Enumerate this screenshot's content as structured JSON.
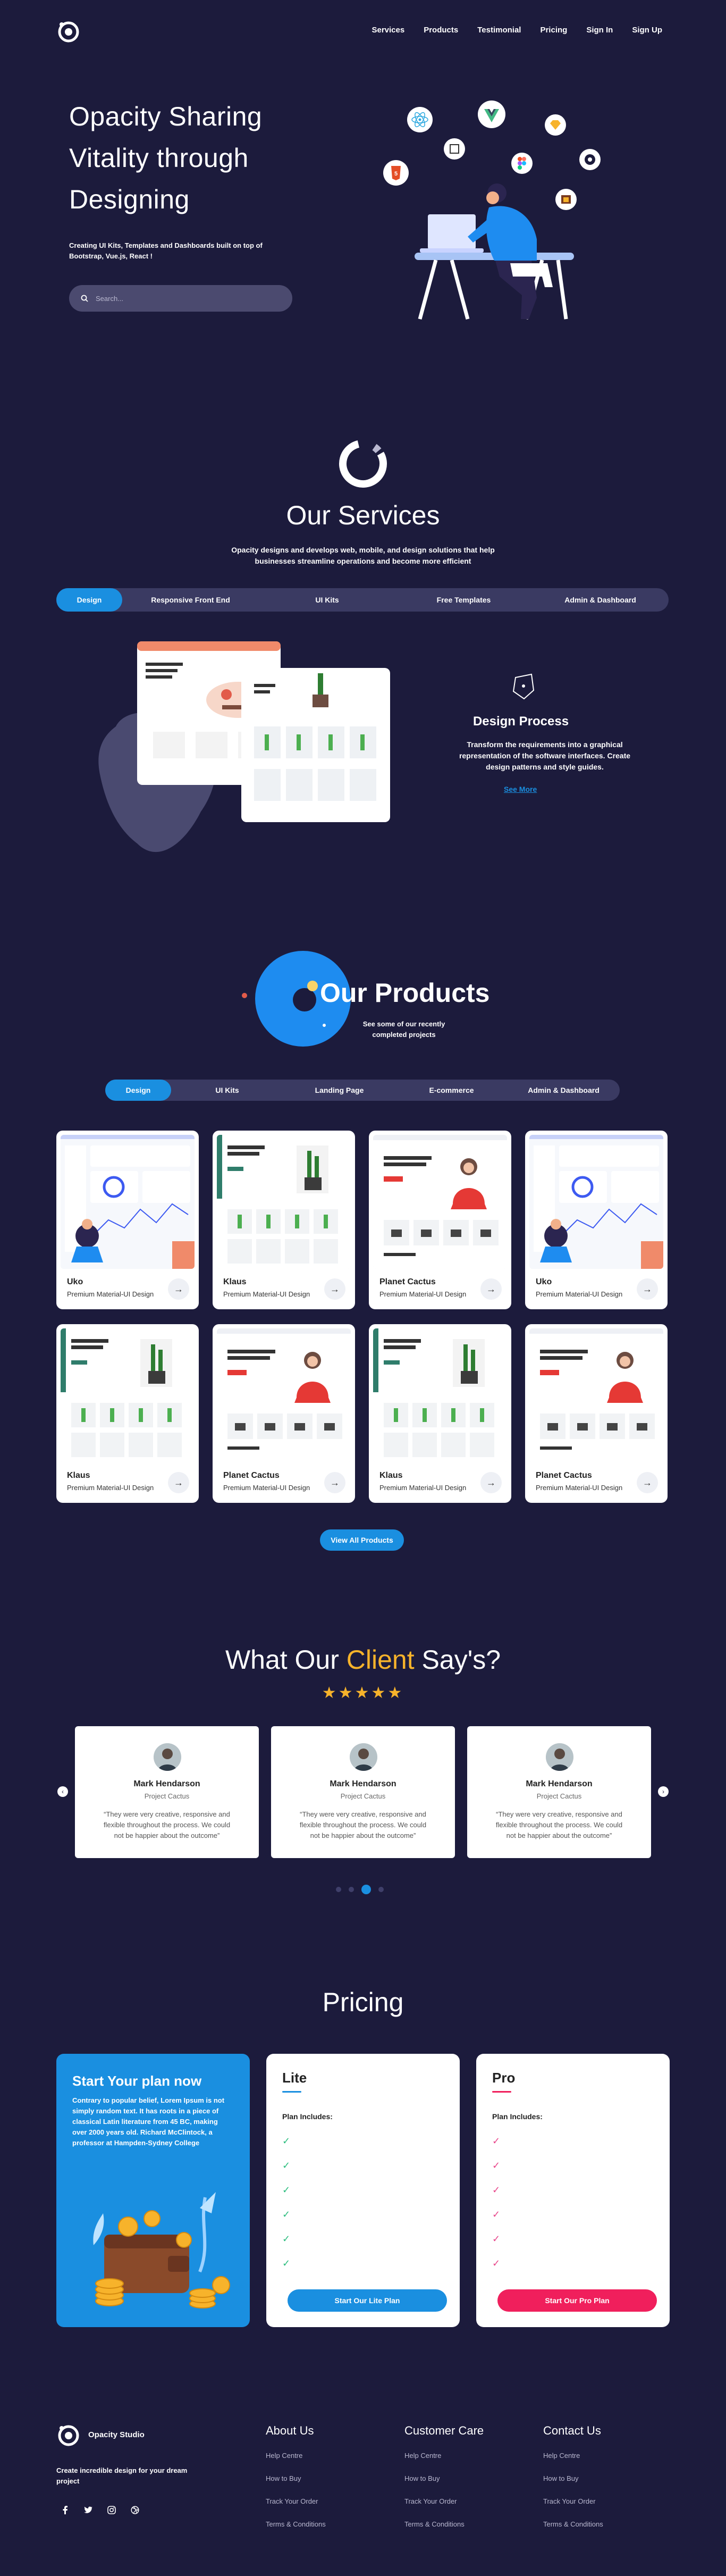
{
  "nav": {
    "links": [
      "Services",
      "Products",
      "Testimonial",
      "Pricing",
      "Sign In",
      "Sign Up"
    ]
  },
  "hero": {
    "title": "Opacity Sharing Vitality through Designing",
    "subtitle": "Creating UI Kits, Templates and Dashboards built on top of Bootstrap, Vue.js, React !",
    "search_placeholder": "Search...",
    "tech_icons": [
      "react-icon",
      "vue-icon",
      "sketch-icon",
      "html5-icon",
      "figma-icon",
      "sass-icon",
      "js-icon",
      "folder-icon"
    ]
  },
  "services": {
    "title": "Our Services",
    "description": "Opacity designs and develops web, mobile, and design solutions that help businesses streamline operations and become more efficient",
    "tabs": [
      "Design",
      "Responsive Front End",
      "UI Kits",
      "Free Templates",
      "Admin & Dashboard"
    ],
    "active_tab": "Design",
    "feature_title": "Design Process",
    "feature_desc": "Transform the requirements into a graphical representation of the software interfaces. Create design patterns and style guides.",
    "see_more": "See More"
  },
  "products": {
    "title": "Our Products",
    "subtitle": "See some of our recently completed projects",
    "tabs": [
      "Design",
      "UI Kits",
      "Landing Page",
      "E-commerce",
      "Admin & Dashboard"
    ],
    "active_tab": "Design",
    "items": [
      {
        "name": "Uko",
        "sub": "Premium Material-UI Design",
        "thumb": "dashboard"
      },
      {
        "name": "Klaus",
        "sub": "Premium Material-UI Design",
        "thumb": "plants"
      },
      {
        "name": "Planet Cactus",
        "sub": "Premium Material-UI Design",
        "thumb": "fashion"
      },
      {
        "name": "Uko",
        "sub": "Premium Material-UI Design",
        "thumb": "dashboard"
      },
      {
        "name": "Klaus",
        "sub": "Premium Material-UI Design",
        "thumb": "plants"
      },
      {
        "name": "Planet Cactus",
        "sub": "Premium Material-UI Design",
        "thumb": "fashion"
      },
      {
        "name": "Klaus",
        "sub": "Premium Material-UI Design",
        "thumb": "plants"
      },
      {
        "name": "Planet Cactus",
        "sub": "Premium Material-UI Design",
        "thumb": "fashion"
      }
    ],
    "view_all": "View All Products"
  },
  "testimonials": {
    "title_a": "What Our ",
    "title_hl": "Client",
    "title_b": " Say's?",
    "stars": "★★★★★",
    "items": [
      {
        "name": "Mark Hendarson",
        "role": "Project Cactus",
        "quote": "“They were very creative, responsive and flexible throughout the process. We could not be happier about the outcome”"
      },
      {
        "name": "Mark Hendarson",
        "role": "Project Cactus",
        "quote": "“They were very creative, responsive and flexible throughout the process. We could not be happier about the outcome”"
      },
      {
        "name": "Mark Hendarson",
        "role": "Project Cactus",
        "quote": "“They were very creative, responsive and flexible throughout the process. We could not be happier about the outcome”"
      }
    ],
    "prev": "‹",
    "next": "›",
    "active_dot": 2
  },
  "pricing": {
    "title": "Pricing",
    "intro_title": "Start Your plan now",
    "intro_desc": "Contrary to popular belief, Lorem Ipsum is not simply random text. It has roots in a piece of classical Latin literature from 45 BC, making over 2000 years old. Richard McClintock, a professor at Hampden-Sydney College",
    "plans": [
      {
        "name": "Lite",
        "includes": "Plan Includes:",
        "button": "Start Our Lite Plan",
        "accent": "#1a8fe0",
        "check_color": "#2bbd7e"
      },
      {
        "name": "Pro",
        "includes": "Plan Includes:",
        "button": "Start Our Pro Plan",
        "accent": "#f01f5c",
        "check_color": "#e8478b"
      }
    ]
  },
  "footer": {
    "brand": "Opacity Studio",
    "tagline": "Create incredible design for your dream project",
    "social_icons": [
      "facebook-icon",
      "twitter-icon",
      "instagram-icon",
      "dribbble-icon"
    ],
    "columns": [
      {
        "title": "About Us",
        "links": [
          "Help Centre",
          "How to Buy",
          "Track Your Order",
          "Terms & Conditions"
        ]
      },
      {
        "title": "Customer Care",
        "links": [
          "Help Centre",
          "How to Buy",
          "Track Your Order",
          "Terms & Conditions"
        ]
      },
      {
        "title": "Contact Us",
        "links": [
          "Help Centre",
          "How to Buy",
          "Track Your Order",
          "Terms & Conditions"
        ]
      }
    ]
  },
  "colors": {
    "background": "#1c1b3c",
    "accent": "#1a8fe0",
    "highlight": "#f7b32b",
    "pro": "#f01f5c"
  }
}
